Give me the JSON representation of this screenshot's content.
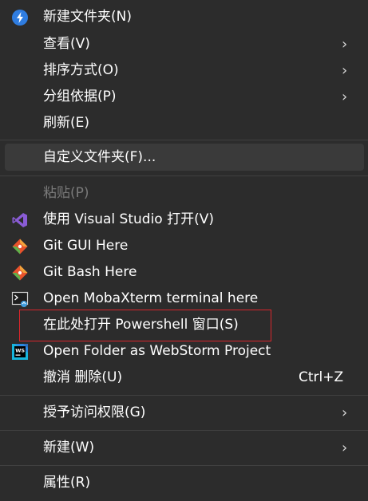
{
  "menu": {
    "items": [
      {
        "label": "新建文件夹(N)",
        "icon": "new-folder-icon"
      },
      {
        "label": "查看(V)",
        "submenu": true
      },
      {
        "label": "排序方式(O)",
        "submenu": true
      },
      {
        "label": "分组依据(P)",
        "submenu": true
      },
      {
        "label": "刷新(E)"
      },
      {
        "label": "自定义文件夹(F)..."
      },
      {
        "label": "粘贴(P)",
        "disabled": true
      },
      {
        "label": "使用 Visual Studio 打开(V)",
        "icon": "visual-studio-icon"
      },
      {
        "label": "Git GUI Here",
        "icon": "git-gui-icon"
      },
      {
        "label": "Git Bash Here",
        "icon": "git-bash-icon"
      },
      {
        "label": "Open MobaXterm terminal here",
        "icon": "mobaxterm-icon"
      },
      {
        "label": "在此处打开 Powershell 窗口(S)"
      },
      {
        "label": "Open Folder as WebStorm Project",
        "icon": "webstorm-icon"
      },
      {
        "label": "撤消 删除(U)",
        "shortcut": "Ctrl+Z"
      },
      {
        "label": "授予访问权限(G)",
        "submenu": true
      },
      {
        "label": "新建(W)",
        "submenu": true
      },
      {
        "label": "属性(R)"
      }
    ],
    "submenu_arrow": "›"
  },
  "colors": {
    "background": "#2c2c2c",
    "highlight": "#3a3a3a",
    "annotation_box": "#d8262b",
    "disabled_text": "#7a7a7a"
  }
}
